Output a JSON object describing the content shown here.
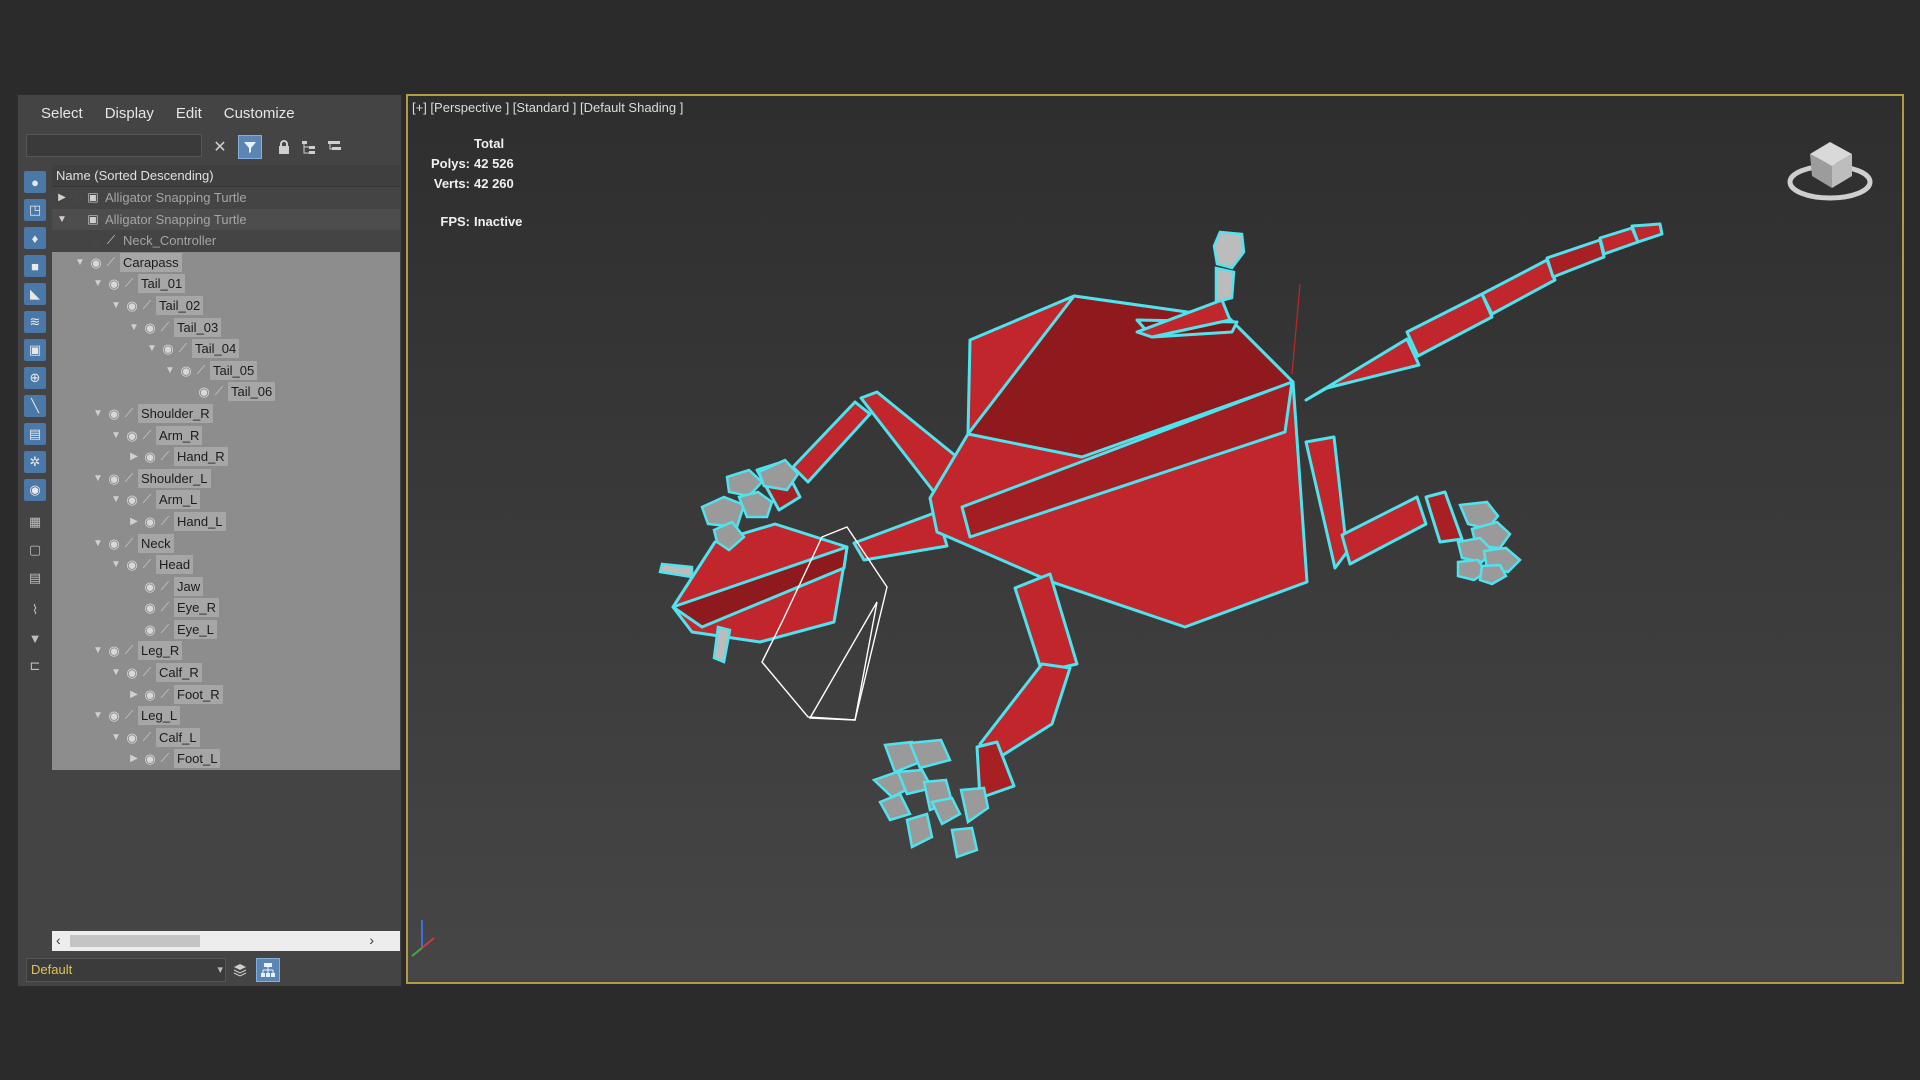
{
  "menu": [
    "Select",
    "Display",
    "Edit",
    "Customize"
  ],
  "search": {
    "value": ""
  },
  "tree": {
    "header": "Name (Sorted Descending)",
    "rows": [
      {
        "label": "Alligator Snapping Turtle",
        "indent": 0,
        "arrow": "right",
        "eye": false,
        "bone": false,
        "dim": true
      },
      {
        "label": "Alligator Snapping Turtle",
        "indent": 0,
        "arrow": "down",
        "eye": false,
        "bone": false,
        "dim": true
      },
      {
        "label": "Neck_Controller",
        "indent": 1,
        "arrow": "",
        "eye": false,
        "bone": true,
        "dim": true
      },
      {
        "label": "Carapass",
        "indent": 1,
        "arrow": "down",
        "eye": true,
        "bone": true
      },
      {
        "label": "Tail_01",
        "indent": 2,
        "arrow": "down",
        "eye": true,
        "bone": true
      },
      {
        "label": "Tail_02",
        "indent": 3,
        "arrow": "down",
        "eye": true,
        "bone": true
      },
      {
        "label": "Tail_03",
        "indent": 4,
        "arrow": "down",
        "eye": true,
        "bone": true
      },
      {
        "label": "Tail_04",
        "indent": 5,
        "arrow": "down",
        "eye": true,
        "bone": true
      },
      {
        "label": "Tail_05",
        "indent": 6,
        "arrow": "down",
        "eye": true,
        "bone": true
      },
      {
        "label": "Tail_06",
        "indent": 7,
        "arrow": "",
        "eye": true,
        "bone": true
      },
      {
        "label": "Shoulder_R",
        "indent": 2,
        "arrow": "down",
        "eye": true,
        "bone": true
      },
      {
        "label": "Arm_R",
        "indent": 3,
        "arrow": "down",
        "eye": true,
        "bone": true
      },
      {
        "label": "Hand_R",
        "indent": 4,
        "arrow": "right",
        "eye": true,
        "bone": true
      },
      {
        "label": "Shoulder_L",
        "indent": 2,
        "arrow": "down",
        "eye": true,
        "bone": true
      },
      {
        "label": "Arm_L",
        "indent": 3,
        "arrow": "down",
        "eye": true,
        "bone": true
      },
      {
        "label": "Hand_L",
        "indent": 4,
        "arrow": "right",
        "eye": true,
        "bone": true
      },
      {
        "label": "Neck",
        "indent": 2,
        "arrow": "down",
        "eye": true,
        "bone": true
      },
      {
        "label": "Head",
        "indent": 3,
        "arrow": "down",
        "eye": true,
        "bone": true
      },
      {
        "label": "Jaw",
        "indent": 4,
        "arrow": "",
        "eye": true,
        "bone": true
      },
      {
        "label": "Eye_R",
        "indent": 4,
        "arrow": "",
        "eye": true,
        "bone": true
      },
      {
        "label": "Eye_L",
        "indent": 4,
        "arrow": "",
        "eye": true,
        "bone": true
      },
      {
        "label": "Leg_R",
        "indent": 2,
        "arrow": "down",
        "eye": true,
        "bone": true
      },
      {
        "label": "Calf_R",
        "indent": 3,
        "arrow": "down",
        "eye": true,
        "bone": true
      },
      {
        "label": "Foot_R",
        "indent": 4,
        "arrow": "right",
        "eye": true,
        "bone": true
      },
      {
        "label": "Leg_L",
        "indent": 2,
        "arrow": "down",
        "eye": true,
        "bone": true
      },
      {
        "label": "Calf_L",
        "indent": 3,
        "arrow": "down",
        "eye": true,
        "bone": true
      },
      {
        "label": "Foot_L",
        "indent": 4,
        "arrow": "right",
        "eye": true,
        "bone": true
      }
    ]
  },
  "layer": {
    "value": "Default"
  },
  "viewport": {
    "label": "[+] [Perspective ] [Standard ] [Default Shading ]",
    "stats": {
      "total_label": "Total",
      "polys_label": "Polys:",
      "polys": "42 526",
      "verts_label": "Verts:",
      "verts": "42 260",
      "fps_label": "FPS:",
      "fps": "Inactive"
    }
  },
  "colors": {
    "panel": "#444444",
    "viewport_border": "#b59a42",
    "model_red": "#c0262b",
    "selection_outline": "#4fe3ee",
    "claw_grey": "#9a9a9a"
  },
  "icons": {
    "sidebar": [
      "display-objects-icon",
      "display-geometry-icon",
      "display-lights-icon",
      "display-cameras-icon",
      "display-helpers-icon",
      "display-spacewarps-icon",
      "display-groups-icon",
      "display-xrefs-icon",
      "display-bones-icon",
      "display-containers-icon",
      "display-frozen-icon",
      "display-hidden-icon",
      "display-all-icon",
      "display-none-icon",
      "display-invert-icon",
      "filter-icon",
      "filter-funnel-icon",
      "selection-set-icon"
    ]
  }
}
